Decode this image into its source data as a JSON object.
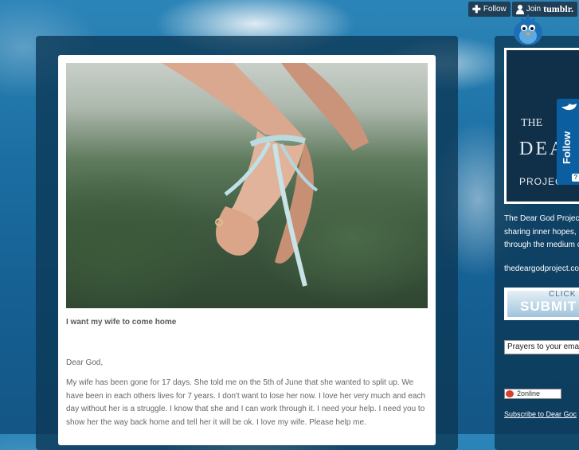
{
  "tumblr": {
    "follow_label": "Follow",
    "join_label": "Join",
    "brand": "tumblr."
  },
  "post": {
    "title": "I want my wife to come home",
    "salutation": "Dear God,",
    "body": "My wife has been gone for 17 days. She told me on the 5th of June that she wanted to split up. We have been in each others lives for 7 years. I don't want to lose her now. I love her very much and each day without her is a struggle. I know that she and I can work through it. I need your help. I need you to show her the way back home and tell her it will be ok. I love my wife. Please help me."
  },
  "sidebar": {
    "logo": {
      "the": "THE",
      "dear": "DEA",
      "project": "PROJECT"
    },
    "follow_widget_label": "Follow",
    "follow_widget_help": "?",
    "description_lines": [
      "The Dear God Projec",
      "sharing inner hopes,",
      "through the medium c"
    ],
    "site_link": "thedeargodproject.co",
    "submit": {
      "click": "CLICK",
      "label": "SUBMIT"
    },
    "prayer_input_value": "Prayers to your ema",
    "online_count": "2online",
    "subscribe_link": "Subscribe to Dear Goc"
  },
  "colors": {
    "panel": "#0c3755",
    "follow_widget": "#0b5fa0"
  }
}
